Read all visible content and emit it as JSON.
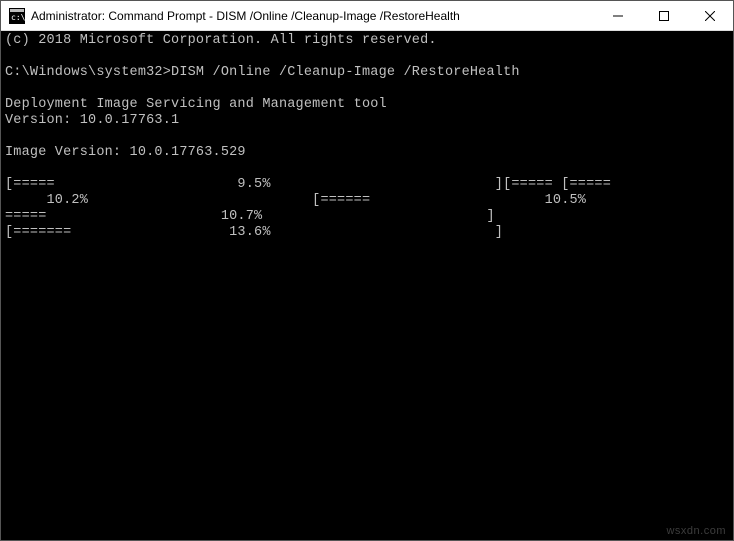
{
  "window": {
    "title": "Administrator: Command Prompt - DISM  /Online /Cleanup-Image /RestoreHealth"
  },
  "terminal": {
    "copyright": "(c) 2018 Microsoft Corporation. All rights reserved.",
    "prompt": "C:\\Windows\\system32>",
    "command": "DISM /Online /Cleanup-Image /RestoreHealth",
    "tool_name": "Deployment Image Servicing and Management tool",
    "tool_version": "Version: 10.0.17763.1",
    "image_version": "Image Version: 10.0.17763.529",
    "progress_line1": "[=====                      9.5%                           ][===== [=====          ",
    "progress_line2": "     10.2%                           [======                     10.5%                           [=",
    "progress_line3": "=====                     10.7%                           ] ",
    "progress_line4": "[=======                   13.6%                           ] "
  },
  "watermark": "wsxdn.com"
}
